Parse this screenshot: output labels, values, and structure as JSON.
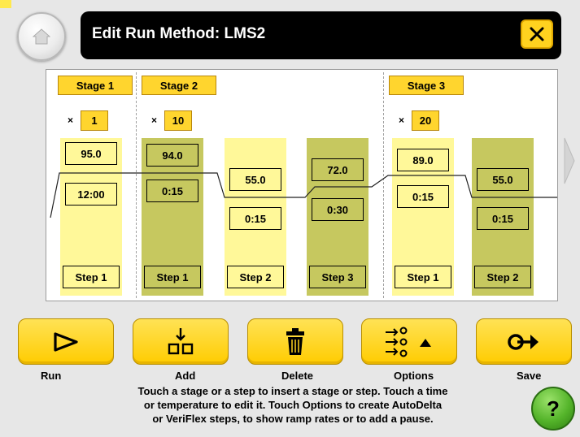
{
  "header": {
    "title": "Edit Run Method: LMS2"
  },
  "stages": [
    {
      "label": "Stage 1",
      "cycle_prefix": "×",
      "cycles": "1"
    },
    {
      "label": "Stage 2",
      "cycle_prefix": "×",
      "cycles": "10"
    },
    {
      "label": "Stage 3",
      "cycle_prefix": "×",
      "cycles": "20"
    }
  ],
  "steps": [
    {
      "stage": "Stage 1",
      "temp": "95.0",
      "time": "12:00",
      "label": "Step 1"
    },
    {
      "stage": "Stage 2",
      "temp": "94.0",
      "time": "0:15",
      "label": "Step 1"
    },
    {
      "stage": "Stage 2",
      "temp": "55.0",
      "time": "0:15",
      "label": "Step 2"
    },
    {
      "stage": "Stage 2",
      "temp": "72.0",
      "time": "0:30",
      "label": "Step 3"
    },
    {
      "stage": "Stage 3",
      "temp": "89.0",
      "time": "0:15",
      "label": "Step 1"
    },
    {
      "stage": "Stage 3",
      "temp": "55.0",
      "time": "0:15",
      "label": "Step 2"
    }
  ],
  "actions": {
    "run": "Run",
    "add": "Add",
    "delete": "Delete",
    "options": "Options",
    "save": "Save"
  },
  "help": {
    "lines": [
      "Touch a stage or a step to insert a stage or step. Touch a time",
      "or temperature to edit it. Touch Options to create AutoDelta",
      "or VeriFlex steps, to show ramp rates or to add a pause."
    ],
    "button": "?"
  },
  "colors": {
    "accent_yellow": "#ffd21f",
    "step_light": "#fff899",
    "step_dark": "#c6c85f",
    "help_green": "#54b42a"
  },
  "icons": {
    "home": "home-icon",
    "close": "close-icon",
    "run": "run-icon",
    "add": "add-step-icon",
    "delete": "trash-icon",
    "options": "options-list-icon",
    "save": "save-icon",
    "next": "chevron-right-icon"
  }
}
